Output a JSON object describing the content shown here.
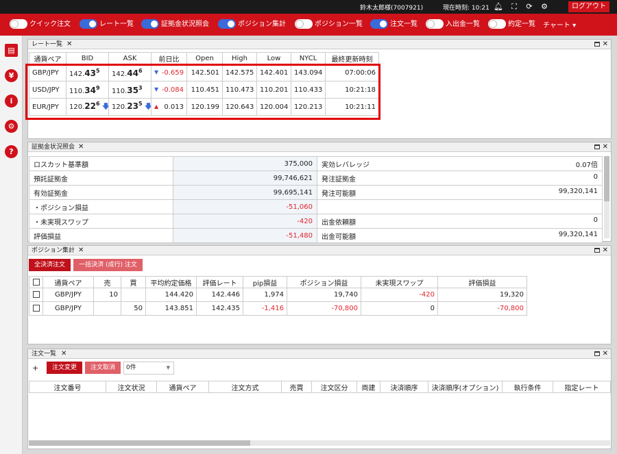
{
  "header": {
    "user": "鈴木太郎様(7007921)",
    "clock": "現在時刻: 10:21",
    "logout": "ログアウト"
  },
  "toggles": [
    {
      "label": "クイック注文",
      "on": false
    },
    {
      "label": "レート一覧",
      "on": true
    },
    {
      "label": "証拠金状況照会",
      "on": true
    },
    {
      "label": "ポジション集計",
      "on": true
    },
    {
      "label": "ポジション一覧",
      "on": false
    },
    {
      "label": "注文一覧",
      "on": true
    },
    {
      "label": "入出金一覧",
      "on": false
    },
    {
      "label": "約定一覧",
      "on": false
    }
  ],
  "chart_menu": "チャート ▾",
  "rate_panel": {
    "title": "レート一覧",
    "columns": [
      "通貨ペア",
      "BID",
      "ASK",
      "前日比",
      "Open",
      "High",
      "Low",
      "NYCL",
      "最終更新時刻"
    ],
    "rows": [
      {
        "pair": "GBP/JPY",
        "bid_pre": "142.",
        "bid_big": "43",
        "bid_sup": "5",
        "bid_arrow": "",
        "ask_pre": "142.",
        "ask_big": "44",
        "ask_sup": "6",
        "ask_arrow": "",
        "trend": "▼",
        "trend_dir": "down",
        "change": "-0.659",
        "change_neg": true,
        "open": "142.501",
        "high": "142.575",
        "low": "142.401",
        "nycl": "143.094",
        "time": "07:00:06"
      },
      {
        "pair": "USD/JPY",
        "bid_pre": "110.",
        "bid_big": "34",
        "bid_sup": "9",
        "bid_arrow": "",
        "ask_pre": "110.",
        "ask_big": "35",
        "ask_sup": "3",
        "ask_arrow": "",
        "trend": "▼",
        "trend_dir": "down",
        "change": "-0.084",
        "change_neg": true,
        "open": "110.451",
        "high": "110.473",
        "low": "110.201",
        "nycl": "110.433",
        "time": "10:21:18"
      },
      {
        "pair": "EUR/JPY",
        "bid_pre": "120.",
        "bid_big": "22",
        "bid_sup": "6",
        "bid_arrow": "🡇",
        "ask_pre": "120.",
        "ask_big": "23",
        "ask_sup": "5",
        "ask_arrow": "🡇",
        "trend": "▲",
        "trend_dir": "up",
        "change": "0.013",
        "change_neg": false,
        "open": "120.199",
        "high": "120.643",
        "low": "120.004",
        "nycl": "120.213",
        "time": "10:21:11"
      }
    ]
  },
  "margin_panel": {
    "title": "証拠金状況照会",
    "rows": [
      {
        "l1": "ロスカット基準額",
        "v1": "375,000",
        "n1": false,
        "l2": "実効レバレッジ",
        "v2": "0.07倍"
      },
      {
        "l1": "預託証拠金",
        "v1": "99,746,621",
        "n1": false,
        "l2": "発注証拠金",
        "v2": "0"
      },
      {
        "l1": "有効証拠金",
        "v1": "99,695,141",
        "n1": false,
        "l2": "発注可能額",
        "v2": "99,320,141"
      },
      {
        "l1": "・ポジション損益",
        "v1": "-51,060",
        "n1": true,
        "l2": "",
        "v2": ""
      },
      {
        "l1": "・未実現スワップ",
        "v1": "-420",
        "n1": true,
        "l2": "出金依頼額",
        "v2": "0"
      },
      {
        "l1": "評価損益",
        "v1": "-51,480",
        "n1": true,
        "l2": "出金可能額",
        "v2": "99,320,141"
      }
    ]
  },
  "position_panel": {
    "title": "ポジション集計",
    "btn_close_all": "全決済注文",
    "btn_bulk_market": "一括決済 (成行) 注文",
    "columns": [
      "通貨ペア",
      "売",
      "買",
      "平均約定価格",
      "評価レート",
      "pip損益",
      "ポジション損益",
      "未実現スワップ",
      "評価損益"
    ],
    "rows": [
      {
        "pair": "GBP/JPY",
        "sell": "10",
        "buy": "",
        "avg": "144.420",
        "rate": "142.446",
        "pip": "1,974",
        "pip_neg": false,
        "pl": "19,740",
        "pl_neg": false,
        "swap": "-420",
        "swap_neg": true,
        "eval": "19,320",
        "eval_neg": false
      },
      {
        "pair": "GBP/JPY",
        "sell": "",
        "buy": "50",
        "avg": "143.851",
        "rate": "142.435",
        "pip": "-1,416",
        "pip_neg": true,
        "pl": "-70,800",
        "pl_neg": true,
        "swap": "0",
        "swap_neg": false,
        "eval": "-70,800",
        "eval_neg": true
      }
    ]
  },
  "order_panel": {
    "title": "注文一覧",
    "plus": "+",
    "btn_modify": "注文変更",
    "btn_cancel": "注文取消",
    "count": "0件",
    "columns": [
      "注文番号",
      "注文状況",
      "通貨ペア",
      "注文方式",
      "売買",
      "注文区分",
      "両建",
      "決済順序",
      "決済順序(オプション)",
      "執行条件",
      "指定レート"
    ]
  },
  "colors": {
    "brand_red": "#d0121b",
    "toggle_on": "#3a6bd8",
    "negative": "#e0242d"
  }
}
